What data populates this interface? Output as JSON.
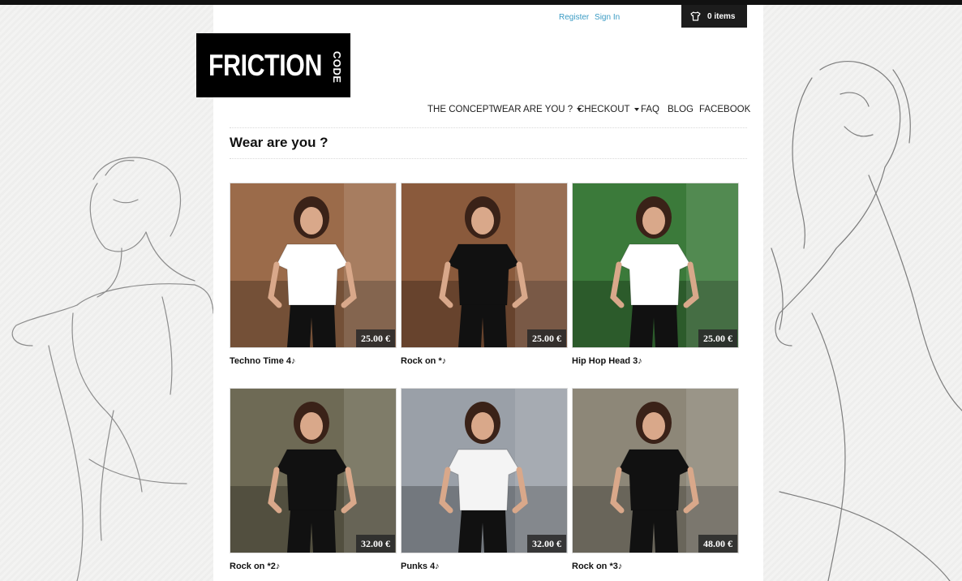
{
  "header": {
    "register_label": "Register",
    "signin_label": "Sign In",
    "cart_label": "0 items",
    "logo_text": "FRICTION",
    "logo_subtext": "CODE"
  },
  "nav": {
    "items": [
      {
        "label": "THE CONCEPT",
        "dropdown": false
      },
      {
        "label": "WEAR ARE YOU ?",
        "dropdown": true
      },
      {
        "label": "CHECKOUT",
        "dropdown": true
      },
      {
        "label": "FAQ",
        "dropdown": false
      },
      {
        "label": "BLOG",
        "dropdown": false
      },
      {
        "label": "FACEBOOK",
        "dropdown": false
      }
    ]
  },
  "page_title": "Wear are you ?",
  "products": [
    {
      "name": "Techno Time 4♪",
      "price": "25.00 €",
      "shirt_color": "#ffffff",
      "bg_color": "#9b6b4a"
    },
    {
      "name": "Rock on *♪",
      "price": "25.00 €",
      "shirt_color": "#111111",
      "bg_color": "#8a5a3c"
    },
    {
      "name": "Hip Hop Head 3♪",
      "price": "25.00 €",
      "shirt_color": "#ffffff",
      "bg_color": "#3b7a3a"
    },
    {
      "name": "Rock on *2♪",
      "price": "32.00 €",
      "shirt_color": "#111111",
      "bg_color": "#6e6a55"
    },
    {
      "name": "Punks 4♪",
      "price": "32.00 €",
      "shirt_color": "#f4f4f4",
      "bg_color": "#9aa0a8"
    },
    {
      "name": "Rock on *3♪",
      "price": "48.00 €",
      "shirt_color": "#111111",
      "bg_color": "#8d8778"
    }
  ],
  "colors": {
    "link": "#3a9bc4",
    "dark": "#1c1c1c"
  }
}
